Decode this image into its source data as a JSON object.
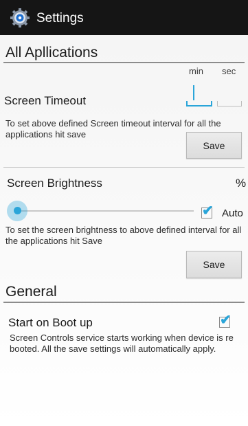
{
  "actionbar": {
    "title": "Settings",
    "icon": "gear-icon"
  },
  "all_apps": {
    "title": "All Apllications",
    "min_label": "min",
    "sec_label": "sec",
    "timeout_label": "Screen Timeout",
    "timeout_min_value": "",
    "timeout_sec_value": "",
    "timeout_desc": "To set above defined Screen timeout interval for all the applications hit save",
    "save_label": "Save",
    "brightness_label": "Screen Brightness",
    "brightness_unit": "%",
    "brightness_level": 0.0,
    "auto_label": "Auto",
    "auto_checked": true,
    "brightness_desc": "To set the screen brightness to above defined interval for all the applications hit Save",
    "save2_label": "Save"
  },
  "general": {
    "title": "General",
    "boot_label": "Start on Boot up",
    "boot_checked": true,
    "boot_desc": "Screen Controls service starts working when device is re booted. All the save settings will automatically apply."
  },
  "colors": {
    "accent": "#2aa5d9",
    "actionbar": "#151515"
  }
}
